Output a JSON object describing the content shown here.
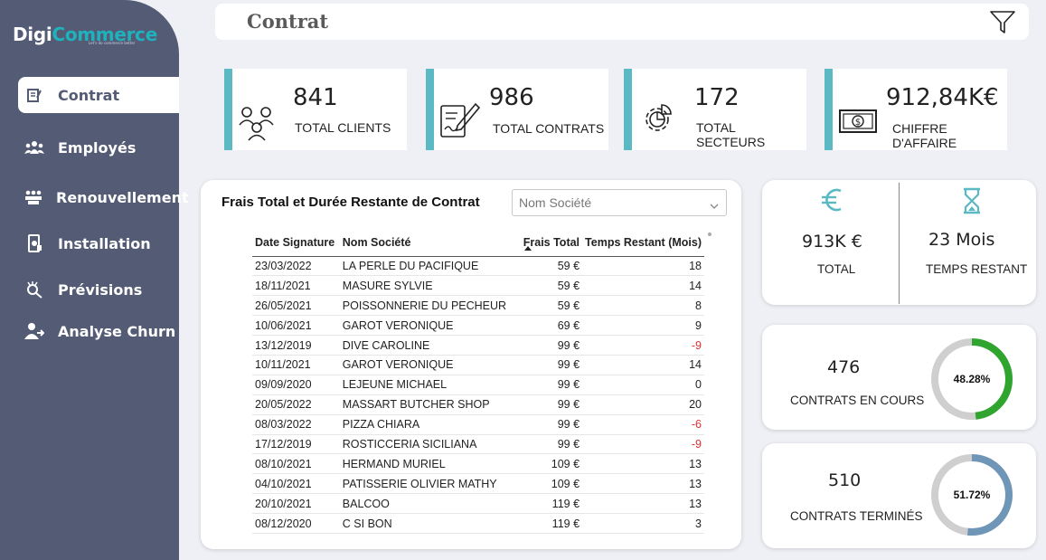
{
  "brand": {
    "name_part1": "Digi",
    "name_part2": "Commerce",
    "tagline": "Let's do commerce better"
  },
  "nav": {
    "items": [
      {
        "label": "Contrat",
        "icon": "contract-icon",
        "active": true
      },
      {
        "label": "Employés",
        "icon": "people-icon"
      },
      {
        "label": "Renouvellement",
        "icon": "group-icon"
      },
      {
        "label": "Installation",
        "icon": "device-icon"
      },
      {
        "label": "Prévisions",
        "icon": "forecast-icon"
      },
      {
        "label": "Analyse Churn",
        "icon": "user-churn-icon"
      }
    ]
  },
  "header": {
    "title": "Contrat",
    "filter_icon": "filter-icon"
  },
  "kpis": [
    {
      "value": "841",
      "label": "TOTAL CLIENTS",
      "icon": "clients-icon"
    },
    {
      "value": "986",
      "label": "TOTAL CONTRATS",
      "icon": "contract-sign-icon"
    },
    {
      "value": "172",
      "label": "TOTAL SECTEURS",
      "icon": "sectors-gear-icon"
    },
    {
      "value": "912,84K€",
      "label": "CHIFFRE D'AFFAIRE",
      "icon": "money-icon"
    }
  ],
  "table": {
    "title": "Frais Total et Durée Restante de Contrat",
    "dropdown_placeholder": "Nom Société",
    "columns": [
      "Date Signature",
      "Nom Société",
      "Frais Total",
      "Temps Restant (Mois)"
    ],
    "rows": [
      [
        "23/03/2022",
        "LA PERLE DU PACIFIQUE",
        "59 €",
        "18"
      ],
      [
        "18/11/2021",
        "MASURE SYLVIE",
        "59 €",
        "14"
      ],
      [
        "26/05/2021",
        "POISSONNERIE DU PECHEUR",
        "59 €",
        "8"
      ],
      [
        "10/06/2021",
        "GAROT VERONIQUE",
        "69 €",
        "9"
      ],
      [
        "13/12/2019",
        "DIVE CAROLINE",
        "99 €",
        "-9"
      ],
      [
        "10/11/2021",
        "GAROT VERONIQUE",
        "99 €",
        "14"
      ],
      [
        "09/09/2020",
        "LEJEUNE MICHAEL",
        "99 €",
        "0"
      ],
      [
        "20/05/2022",
        "MASSART BUTCHER SHOP",
        "99 €",
        "20"
      ],
      [
        "08/03/2022",
        "PIZZA CHIARA",
        "99 €",
        "-6"
      ],
      [
        "17/12/2019",
        "ROSTICCERIA SICILIANA",
        "99 €",
        "-9"
      ],
      [
        "08/10/2021",
        "HERMAND MURIEL",
        "109 €",
        "13"
      ],
      [
        "04/10/2021",
        "PATISSERIE OLIVIER MATHY",
        "109 €",
        "13"
      ],
      [
        "20/10/2021",
        "BALCOO",
        "119 €",
        "13"
      ],
      [
        "08/12/2020",
        "C SI BON",
        "119 €",
        "3"
      ]
    ]
  },
  "totals": {
    "total_value": "913K €",
    "total_label": "TOTAL",
    "total_icon": "euro-icon",
    "remaining_value": "23  Mois",
    "remaining_label": "TEMPS RESTANT",
    "remaining_icon": "hourglass-icon"
  },
  "gauges": [
    {
      "value": "476",
      "label": "CONTRATS EN COURS",
      "percent_text": "48.28%",
      "percent": 48.28,
      "color": "#2fa52f"
    },
    {
      "value": "510",
      "label": "CONTRATS TERMINÉS",
      "percent_text": "51.72%",
      "percent": 51.72,
      "color": "#6f96b6"
    }
  ],
  "colors": {
    "sidebar": "#545b75",
    "accent": "#5ab9c3",
    "negative": "#e03030"
  }
}
